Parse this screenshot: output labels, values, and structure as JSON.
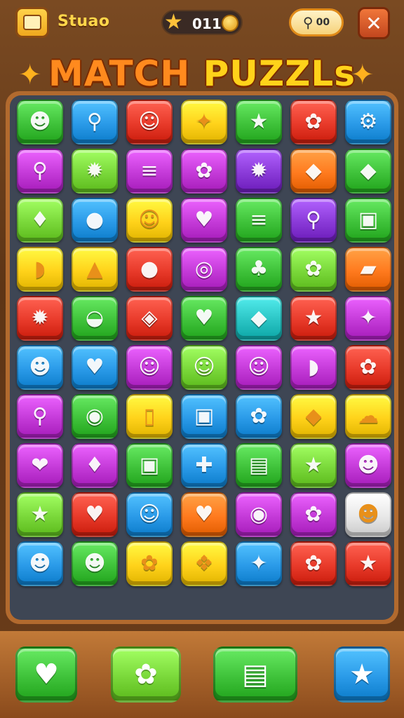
{
  "header": {
    "app_name": "Stuao",
    "score": "011",
    "search_label": "00",
    "close_label": "✕"
  },
  "title": {
    "part1": "MATCH ",
    "part2": "PUZZLs"
  },
  "colors": {
    "green": "#3fc23a",
    "blue": "#2a9ae8",
    "red": "#e83a2a",
    "yellow": "#ffd21a",
    "magenta": "#c43ad8",
    "purple": "#8a3ad8",
    "orange": "#ff7a1e",
    "lime": "#7ad83a",
    "pink": "#f04a8a",
    "teal": "#2ac4c4"
  },
  "board": {
    "rows": [
      [
        {
          "c": "green",
          "i": "☻"
        },
        {
          "c": "blue",
          "i": "⚲"
        },
        {
          "c": "red",
          "i": "☺"
        },
        {
          "c": "yellow",
          "i": "✦"
        },
        {
          "c": "green",
          "i": "★"
        },
        {
          "c": "red",
          "i": "✿"
        },
        {
          "c": "blue",
          "i": "⚙"
        }
      ],
      [
        {
          "c": "magenta",
          "i": "⚲"
        },
        {
          "c": "lime",
          "i": "✹"
        },
        {
          "c": "magenta",
          "i": "≡"
        },
        {
          "c": "magenta",
          "i": "✿"
        },
        {
          "c": "purple",
          "i": "✹"
        },
        {
          "c": "orange",
          "i": "◆"
        },
        {
          "c": "green",
          "i": "◆"
        }
      ],
      [
        {
          "c": "lime",
          "i": "♦"
        },
        {
          "c": "blue",
          "i": "●"
        },
        {
          "c": "yellow",
          "i": "☺"
        },
        {
          "c": "magenta",
          "i": "♥"
        },
        {
          "c": "green",
          "i": "≡"
        },
        {
          "c": "purple",
          "i": "⚲"
        },
        {
          "c": "green",
          "i": "▣"
        }
      ],
      [
        {
          "c": "yellow",
          "i": "◗"
        },
        {
          "c": "yellow",
          "i": "▲"
        },
        {
          "c": "red",
          "i": "●"
        },
        {
          "c": "magenta",
          "i": "◎"
        },
        {
          "c": "green",
          "i": "♣"
        },
        {
          "c": "lime",
          "i": "✿"
        },
        {
          "c": "orange",
          "i": "▰"
        }
      ],
      [
        {
          "c": "red",
          "i": "✹"
        },
        {
          "c": "green",
          "i": "◒"
        },
        {
          "c": "red",
          "i": "◈"
        },
        {
          "c": "green",
          "i": "♥"
        },
        {
          "c": "teal",
          "i": "◆"
        },
        {
          "c": "red",
          "i": "★"
        },
        {
          "c": "magenta",
          "i": "✦"
        }
      ],
      [
        {
          "c": "blue",
          "i": "☻"
        },
        {
          "c": "blue",
          "i": "♥"
        },
        {
          "c": "magenta",
          "i": "☺"
        },
        {
          "c": "lime",
          "i": "☺"
        },
        {
          "c": "magenta",
          "i": "☺"
        },
        {
          "c": "magenta",
          "i": "◗"
        },
        {
          "c": "red",
          "i": "✿"
        }
      ],
      [
        {
          "c": "magenta",
          "i": "⚲"
        },
        {
          "c": "green",
          "i": "◉"
        },
        {
          "c": "yellow",
          "i": "▯"
        },
        {
          "c": "blue",
          "i": "▣"
        },
        {
          "c": "blue",
          "i": "✿"
        },
        {
          "c": "yellow",
          "i": "◆"
        },
        {
          "c": "yellow",
          "i": "☁"
        }
      ],
      [
        {
          "c": "magenta",
          "i": "❤"
        },
        {
          "c": "magenta",
          "i": "♦"
        },
        {
          "c": "green",
          "i": "▣"
        },
        {
          "c": "blue",
          "i": "✚"
        },
        {
          "c": "green",
          "i": "▤"
        },
        {
          "c": "lime",
          "i": "★"
        },
        {
          "c": "magenta",
          "i": "☻"
        }
      ],
      [
        {
          "c": "lime",
          "i": "★"
        },
        {
          "c": "red",
          "i": "♥"
        },
        {
          "c": "blue",
          "i": "☺"
        },
        {
          "c": "orange",
          "i": "♥"
        },
        {
          "c": "magenta",
          "i": "◉"
        },
        {
          "c": "magenta",
          "i": "✿"
        },
        {
          "c": "white",
          "i": "☻"
        }
      ],
      [
        {
          "c": "blue",
          "i": "☻"
        },
        {
          "c": "green",
          "i": "☻"
        },
        {
          "c": "yellow",
          "i": "✿"
        },
        {
          "c": "yellow",
          "i": "❖"
        },
        {
          "c": "blue",
          "i": "✦"
        },
        {
          "c": "red",
          "i": "✿"
        },
        {
          "c": "red",
          "i": "★"
        }
      ]
    ]
  },
  "powerups": [
    {
      "name": "powerup-heart",
      "c": "green",
      "i": "♥"
    },
    {
      "name": "powerup-flower",
      "c": "lime",
      "i": "✿"
    },
    {
      "name": "powerup-cards",
      "c": "green",
      "i": "▤"
    },
    {
      "name": "powerup-star",
      "c": "blue",
      "i": "★"
    }
  ]
}
